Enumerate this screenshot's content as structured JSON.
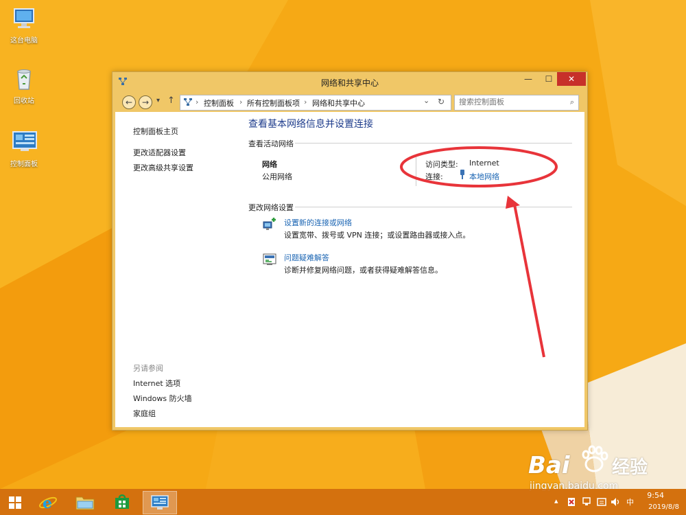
{
  "desktop": {
    "icons": [
      {
        "label": "这台电脑"
      },
      {
        "label": "回收站"
      },
      {
        "label": "控制面板"
      }
    ]
  },
  "window": {
    "title": "网络和共享中心",
    "controls": {
      "minimize": "—",
      "maximize": "☐",
      "close": "✕"
    },
    "nav": {
      "back": "←",
      "forward": "→",
      "recent": "▾",
      "up": "↑",
      "breadcrumb": [
        "控制面板",
        "所有控制面板项",
        "网络和共享中心"
      ],
      "separator": "›",
      "dropdown": "⌄",
      "refresh": "↻"
    },
    "search": {
      "placeholder": "搜索控制面板",
      "icon": "search-icon"
    }
  },
  "sidebar": {
    "home": "控制面板主页",
    "links": [
      "更改适配器设置",
      "更改高级共享设置"
    ],
    "see_also_header": "另请参阅",
    "see_also": [
      "Internet 选项",
      "Windows 防火墙",
      "家庭组"
    ]
  },
  "main": {
    "title": "查看基本网络信息并设置连接",
    "active_networks_header": "查看活动网络",
    "network": {
      "name": "网络",
      "type": "公用网络",
      "access_type_label": "访问类型:",
      "access_type_value": "Internet",
      "connections_label": "连接:",
      "connection_link": "本地网络"
    },
    "change_settings_header": "更改网络设置",
    "tasks": [
      {
        "link": "设置新的连接或网络",
        "desc": "设置宽带、拨号或 VPN 连接；或设置路由器或接入点。"
      },
      {
        "link": "问题疑难解答",
        "desc": "诊断并修复网络问题，或者获得疑难解答信息。"
      }
    ]
  },
  "taskbar": {
    "tray": {
      "chevron": "▴",
      "ime": "中",
      "time": "9:54",
      "date": "2019/8/8"
    }
  },
  "watermark": {
    "brand": "Bai",
    "brand2": "经验",
    "url": "jingyan.baidu.com"
  },
  "colors": {
    "accent_link": "#1b65b3",
    "title_blue": "#1e3c8c",
    "annotation_red": "#e8343a",
    "close_red": "#c7302a",
    "desktop_orange": "#f5a711"
  }
}
